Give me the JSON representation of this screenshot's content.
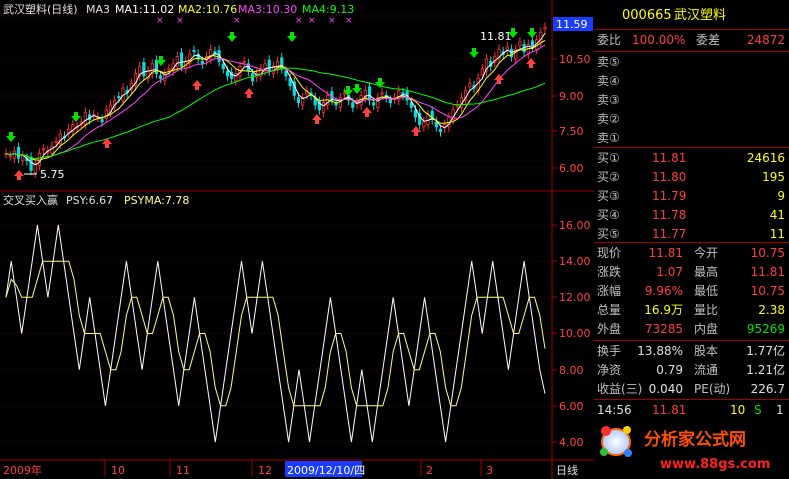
{
  "top_legend": {
    "title": "武汉塑料(日线)",
    "ma3": "MA3",
    "ma1": "MA1:11.02",
    "ma2": "MA2:10.76",
    "ma3v": "MA3:10.30",
    "ma4": "MA4:9.13"
  },
  "price_axis": [
    "10.50",
    "9.00",
    "7.50",
    "6.00"
  ],
  "price_current": "11.59",
  "annot_high": "11.81",
  "annot_low": "5.75",
  "sub_legend": {
    "name": "交叉买入赢",
    "psy": "PSY:6.67",
    "psyma": "PSYMA:7.78"
  },
  "psy_axis": [
    "16.00",
    "14.00",
    "12.00",
    "10.00",
    "8.00",
    "6.00",
    "4.00"
  ],
  "date_axis": {
    "labels": [
      "2009年",
      "10",
      "11",
      "12",
      "2009/12/10/四",
      "2",
      "3"
    ],
    "period": "日线"
  },
  "colors": {
    "up": "#ff3030",
    "down": "#00e0e0",
    "ma1": "#ffffff",
    "ma2": "#ffff00",
    "ma3": "#ff40ff",
    "ma4": "#00ff00",
    "psy": "#ffffff",
    "psyma": "#ffff80",
    "grid": "#a00000"
  },
  "stock": {
    "code": "000665",
    "name": "武汉塑料"
  },
  "weibi": {
    "label": "委比",
    "value": "100.00%",
    "cha_label": "委差",
    "cha_value": "24872"
  },
  "sell": [
    {
      "label": "卖⑤",
      "price": "",
      "vol": ""
    },
    {
      "label": "卖④",
      "price": "",
      "vol": ""
    },
    {
      "label": "卖③",
      "price": "",
      "vol": ""
    },
    {
      "label": "卖②",
      "price": "",
      "vol": ""
    },
    {
      "label": "卖①",
      "price": "",
      "vol": ""
    }
  ],
  "buy": [
    {
      "label": "买①",
      "price": "11.81",
      "vol": "24616"
    },
    {
      "label": "买②",
      "price": "11.80",
      "vol": "195"
    },
    {
      "label": "买③",
      "price": "11.79",
      "vol": "9"
    },
    {
      "label": "买④",
      "price": "11.78",
      "vol": "41"
    },
    {
      "label": "买⑤",
      "price": "11.77",
      "vol": "11"
    }
  ],
  "quote": [
    {
      "l1": "现价",
      "v1": "11.81",
      "l2": "今开",
      "v2": "10.75"
    },
    {
      "l1": "涨跌",
      "v1": "1.07",
      "l2": "最高",
      "v2": "11.81"
    },
    {
      "l1": "涨幅",
      "v1": "9.96%",
      "l2": "最低",
      "v2": "10.75"
    },
    {
      "l1": "总量",
      "v1": "16.9万",
      "l2": "量比",
      "v2": "2.38"
    },
    {
      "l1": "外盘",
      "v1": "73285",
      "l2": "内盘",
      "v2": "95269"
    }
  ],
  "fund": [
    {
      "l1": "换手",
      "v1": "13.88%",
      "l2": "股本",
      "v2": "1.77亿"
    },
    {
      "l1": "净资",
      "v1": "0.79",
      "l2": "流通",
      "v2": "1.21亿"
    },
    {
      "l1": "收益(三)",
      "v1": "0.040",
      "l2": "PE(动)",
      "v2": "226.7"
    }
  ],
  "tick": {
    "time": "14:56",
    "price": "11.81",
    "vol": "10",
    "side": "S",
    "count": "1"
  },
  "logo": {
    "text": "分析家公式网",
    "url": "www.88gs.com"
  }
}
